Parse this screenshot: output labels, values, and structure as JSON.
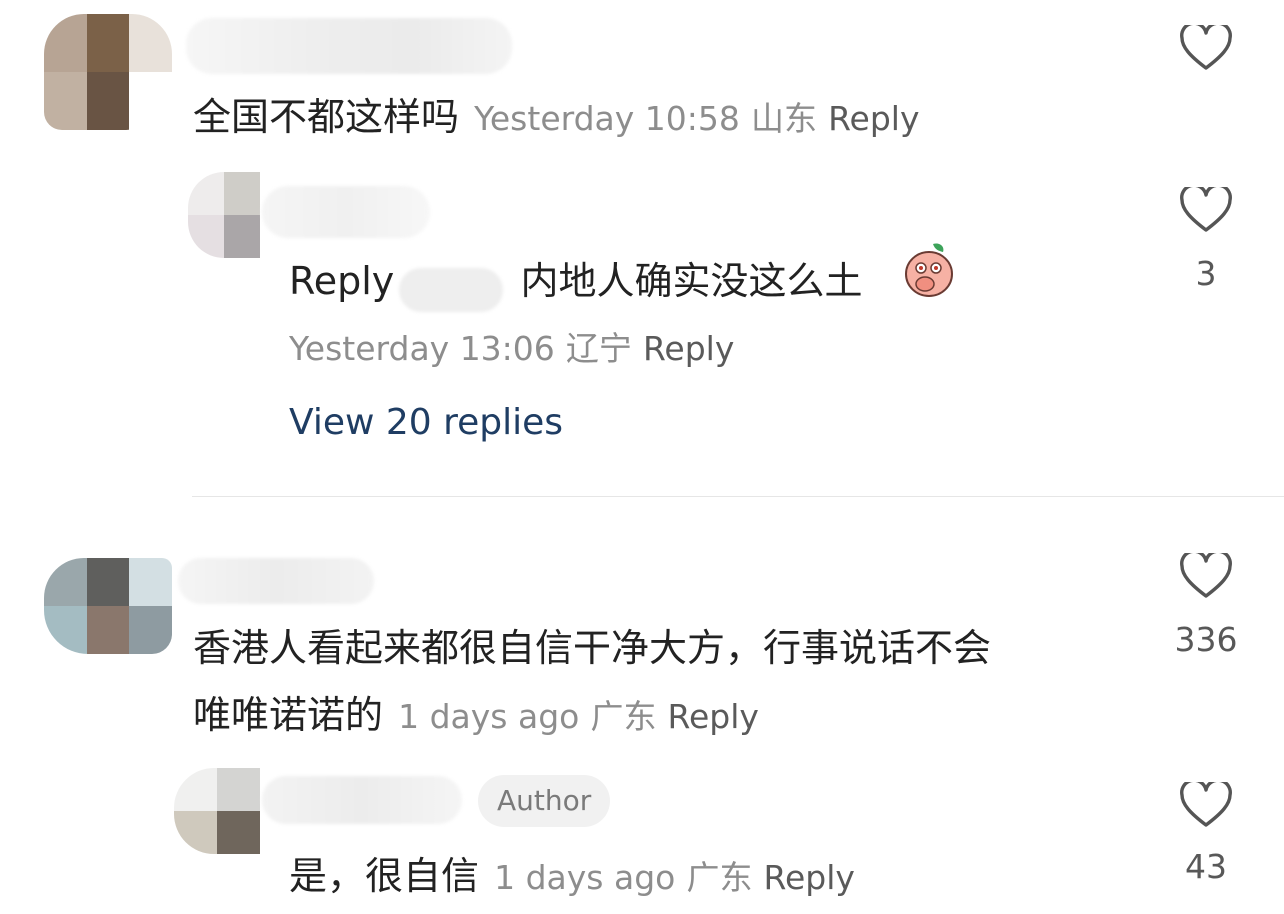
{
  "comments": [
    {
      "text": "全国不都这样吗",
      "time": "Yesterday 10:58",
      "location": "山东",
      "reply_label": "Reply",
      "avatar_colors": [
        "#b7a494",
        "#7b6148",
        "#c9bcae",
        "#c1b1a2",
        "#695444",
        "#d8d0c8"
      ],
      "replies": [
        {
          "prefix": "Reply",
          "text": "内地人确实没这么土",
          "emoji": "peach-face-emoji",
          "time": "Yesterday 13:06",
          "location": "辽宁",
          "reply_label": "Reply",
          "likes": "3",
          "avatar_colors": [
            "#e7e4e3",
            "#cfcdc8",
            "#e3dde0",
            "#aaa6a8"
          ]
        }
      ],
      "view_replies": "View 20 replies"
    },
    {
      "text_line1": "香港人看起来都很自信干净大方，行事说话不会",
      "text_line2": "唯唯诺诺的",
      "time": "1 days ago",
      "location": "广东",
      "reply_label": "Reply",
      "likes": "336",
      "avatar_colors": [
        "#9aa7ab",
        "#5f5f5d",
        "#c9d7dc",
        "#a4bcc2",
        "#8a776c",
        "#8e9ba1"
      ],
      "replies": [
        {
          "author_badge": "Author",
          "text": "是，很自信",
          "time": "1 days ago",
          "location": "广东",
          "reply_label": "Reply",
          "likes": "43",
          "avatar_colors": [
            "#e6e6e4",
            "#d4d4d2",
            "#cfc9bd",
            "#6f665c"
          ]
        }
      ]
    }
  ],
  "icons": {
    "like": "heart-outline-icon"
  },
  "colors": {
    "link_blue": "#1f3d63",
    "meta_gray": "#8d8d8d",
    "text": "#222222"
  }
}
